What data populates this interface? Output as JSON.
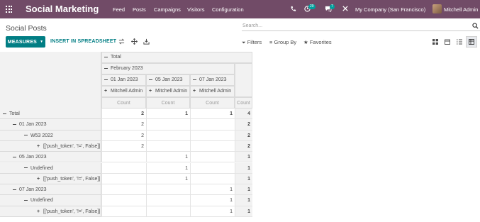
{
  "navbar": {
    "brand": "Social Marketing",
    "menu": [
      "Feed",
      "Posts",
      "Campaigns",
      "Visitors",
      "Configuration"
    ],
    "activity_count": "29",
    "message_count": "7",
    "company": "My Company (San Francisco)",
    "user": "Mitchell Admin"
  },
  "control": {
    "title": "Social Posts",
    "search_placeholder": "Search...",
    "measures_label": "MEASURES",
    "spreadsheet_label": "INSERT IN SPREADSHEET",
    "filters_label": "Filters",
    "groupby_label": "Group By",
    "favorites_label": "Favorites"
  },
  "pivot": {
    "col_total": "Total",
    "col_month": "February 2023",
    "col_dates": [
      "01 Jan 2023",
      "05 Jan 2023",
      "07 Jan 2023"
    ],
    "col_users": [
      "Mitchell Admin",
      "Mitchell Admin",
      "Mitchell Admin"
    ],
    "measure": "Count",
    "rows": [
      {
        "label": "Total",
        "icon": "minus",
        "indent": 0,
        "values": [
          "2",
          "1",
          "1",
          "4"
        ],
        "bold": true
      },
      {
        "label": "01 Jan 2023",
        "icon": "minus",
        "indent": 1,
        "values": [
          "2",
          "",
          "",
          "2"
        ],
        "bold": false
      },
      {
        "label": "W53 2022",
        "icon": "minus",
        "indent": 2,
        "values": [
          "2",
          "",
          "",
          "2"
        ],
        "bold": false
      },
      {
        "label": "[['push_token', '!=', False]]",
        "icon": "plus",
        "indent": 3,
        "values": [
          "2",
          "",
          "",
          "2"
        ],
        "bold": false
      },
      {
        "label": "05 Jan 2023",
        "icon": "minus",
        "indent": 1,
        "values": [
          "",
          "1",
          "",
          "1"
        ],
        "bold": false
      },
      {
        "label": "Undefined",
        "icon": "minus",
        "indent": 2,
        "values": [
          "",
          "1",
          "",
          "1"
        ],
        "bold": false
      },
      {
        "label": "[['push_token', '!=', False]]",
        "icon": "plus",
        "indent": 3,
        "values": [
          "",
          "1",
          "",
          "1"
        ],
        "bold": false
      },
      {
        "label": "07 Jan 2023",
        "icon": "minus",
        "indent": 1,
        "values": [
          "",
          "",
          "1",
          "1"
        ],
        "bold": false
      },
      {
        "label": "Undefined",
        "icon": "minus",
        "indent": 2,
        "values": [
          "",
          "",
          "1",
          "1"
        ],
        "bold": false
      },
      {
        "label": "[['push_token', '!=', False]]",
        "icon": "plus",
        "indent": 3,
        "values": [
          "",
          "",
          "1",
          "1"
        ],
        "bold": false
      }
    ]
  }
}
